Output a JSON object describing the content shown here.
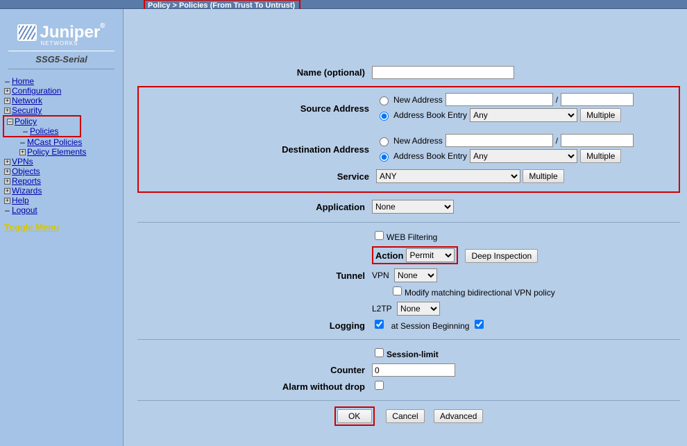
{
  "breadcrumb": "Policy > Policies (From Trust To Untrust)",
  "logo": {
    "brand": "Juniper",
    "sub": "NETWORKS",
    "reg": "®"
  },
  "device": "SSG5-Serial",
  "nav": {
    "home": "Home",
    "configuration": "Configuration",
    "network": "Network",
    "security": "Security",
    "policy": "Policy",
    "policy_sub": {
      "policies": "Policies",
      "mcast": "MCast Policies",
      "elements": "Policy Elements"
    },
    "vpns": "VPNs",
    "objects": "Objects",
    "reports": "Reports",
    "wizards": "Wizards",
    "help": "Help",
    "logout": "Logout"
  },
  "toggle": "Toggle Menu",
  "form": {
    "name_lbl": "Name (optional)",
    "src_lbl": "Source Address",
    "dst_lbl": "Destination Address",
    "new_addr": "New Address",
    "book_entry": "Address Book Entry",
    "any": "Any",
    "multiple_btn": "Multiple",
    "slash": "/",
    "service_lbl": "Service",
    "service_val": "ANY",
    "application_lbl": "Application",
    "application_val": "None",
    "webfilter": "WEB Filtering",
    "action_lbl": "Action",
    "action_val": "Permit",
    "deep_btn": "Deep Inspection",
    "tunnel_lbl": "Tunnel",
    "vpn_lbl": "VPN",
    "vpn_val": "None",
    "modify_bidir": "Modify matching bidirectional VPN policy",
    "l2tp_lbl": "L2TP",
    "l2tp_val": "None",
    "logging_lbl": "Logging",
    "logging_at": "at Session Beginning",
    "session_limit": "Session-limit",
    "counter_lbl": "Counter",
    "counter_val": "0",
    "alarm_lbl": "Alarm without drop",
    "ok": "OK",
    "cancel": "Cancel",
    "advanced": "Advanced"
  }
}
